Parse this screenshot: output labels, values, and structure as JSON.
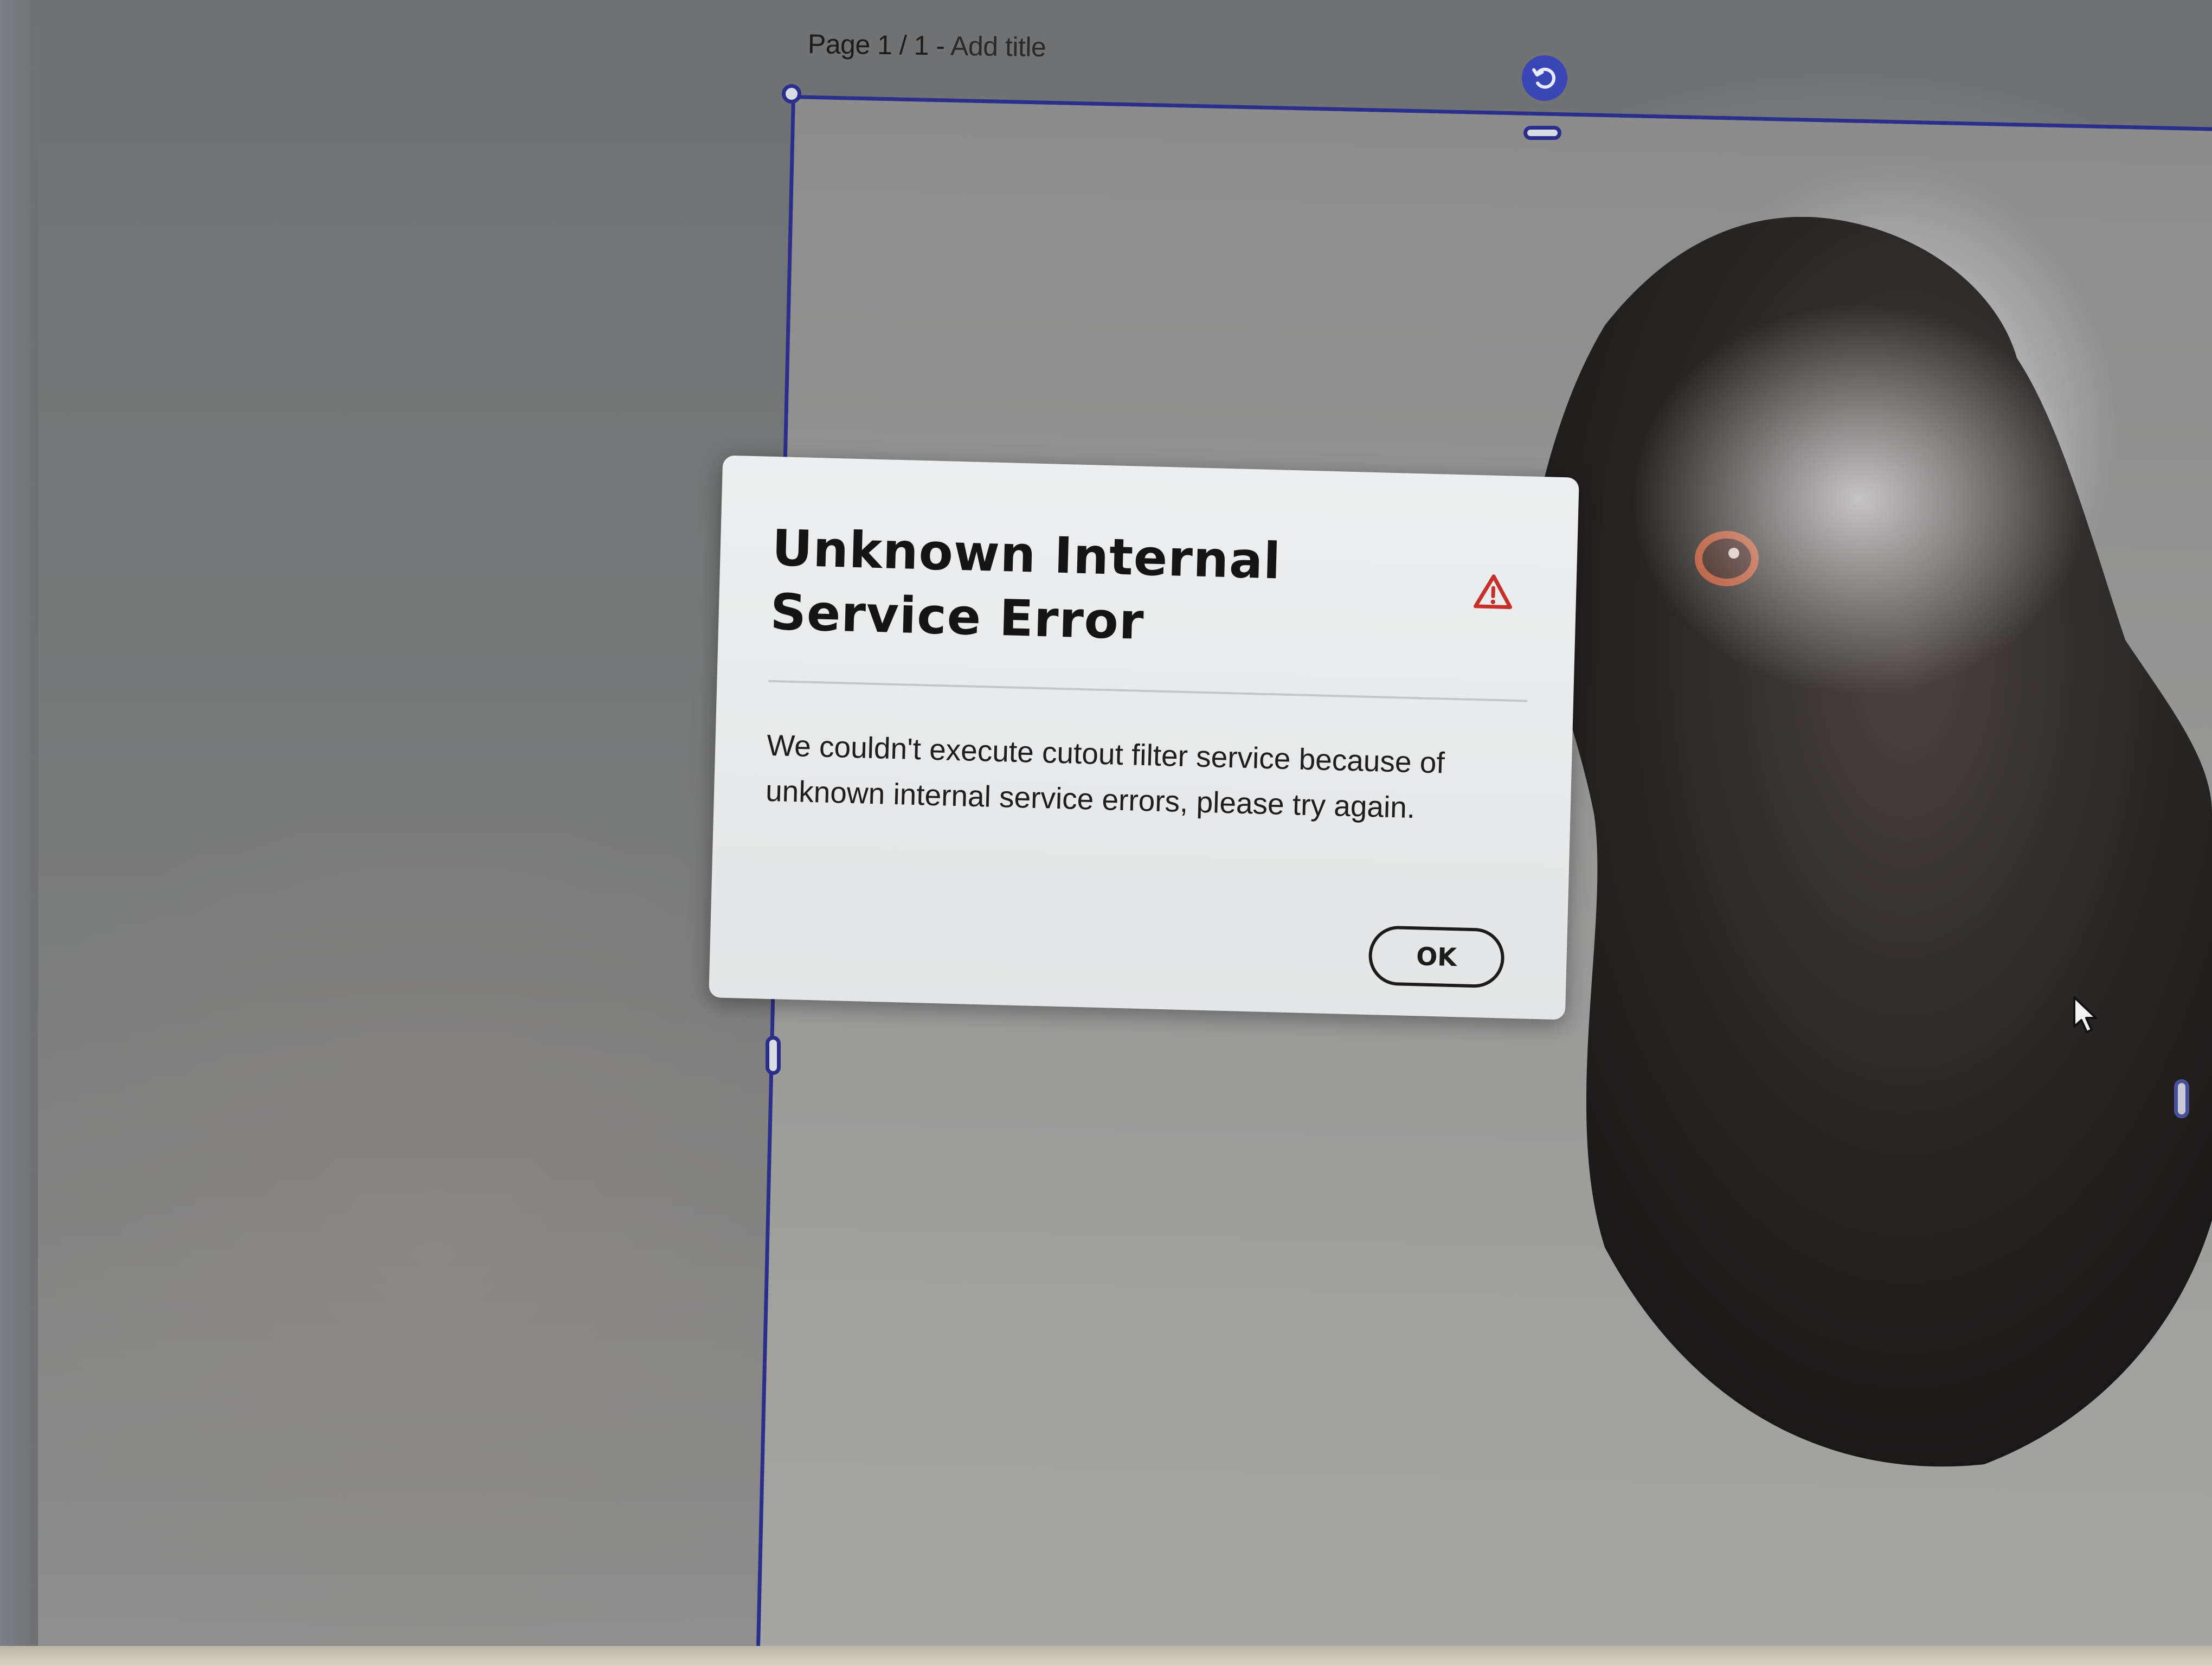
{
  "canvas": {
    "page_label": "Page 1 / 1 - ",
    "title_link": "Add title"
  },
  "dialog": {
    "title": "Unknown Internal Service Error",
    "icon": "alert-triangle-icon",
    "message": "We couldn't execute cutout filter service because of unknown internal service errors, please try again.",
    "ok_label": "OK"
  },
  "colors": {
    "selection": "#2b2f8c",
    "rotate_handle": "#3a46b6",
    "alert": "#c7302a"
  },
  "icons": {
    "rotate": "rotate-icon",
    "cursor": "mouse-pointer-icon"
  }
}
